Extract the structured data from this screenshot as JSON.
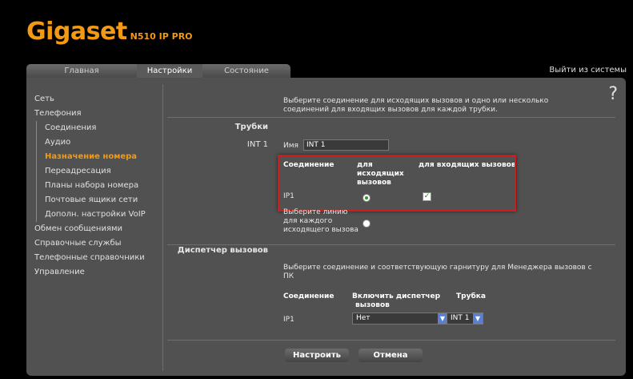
{
  "header": {
    "brand": "Gigaset",
    "model": "N510 IP PRO",
    "logout": "Выйти из системы"
  },
  "tabs": [
    "Главная",
    "Настройки",
    "Состояние"
  ],
  "help": "?",
  "nav": {
    "network": "Сеть",
    "telephony": "Телефония",
    "connections": "Соединения",
    "audio": "Аудио",
    "number_assignment": "Назначение номера",
    "call_forwarding": "Переадресация",
    "dialling_plans": "Планы набора номера",
    "network_mailboxes": "Почтовые ящики сети",
    "voip_advanced": "Дополн. настройки VoIP",
    "messaging": "Обмен сообщениями",
    "info_services": "Справочные службы",
    "directories": "Телефонные справочники",
    "management": "Управление"
  },
  "handsets": {
    "intro_line1": "Выберите соединение для исходящих вызовов и одно или несколько",
    "intro_line2": "соединений для входящих вызовов для каждой трубки.",
    "section": "Трубки",
    "handset_id": "INT 1",
    "name_label": "Имя",
    "name_value": "INT 1",
    "col_connection": "Соединение",
    "col_outgoing_1": "для",
    "col_outgoing_2": "исходящих",
    "col_outgoing_3": "вызовов",
    "col_incoming": "для входящих вызовов",
    "row_conn": "IP1",
    "outgoing_selected": true,
    "incoming_checked": true,
    "line_select_1": "Выберите линию",
    "line_select_2": "для каждого",
    "line_select_3": "исходящего вызова"
  },
  "call_manager": {
    "section": "Диспетчер вызовов",
    "intro_line1": "Выберите соединение и соответствующую гарнитуру для Менеджера вызовов с",
    "intro_line2": "ПК",
    "col_connection": "Соединение",
    "col_enable_1": "Включить диспетчер",
    "col_enable_2": "вызовов",
    "col_handset": "Трубка",
    "row_conn": "IP1",
    "enable_value": "Нет",
    "handset_value": "INT 1"
  },
  "buttons": {
    "apply": "Настроить",
    "cancel": "Отмена"
  },
  "colors": {
    "accent": "#f39a12",
    "highlight": "#d11a1a",
    "panel": "#515151"
  }
}
